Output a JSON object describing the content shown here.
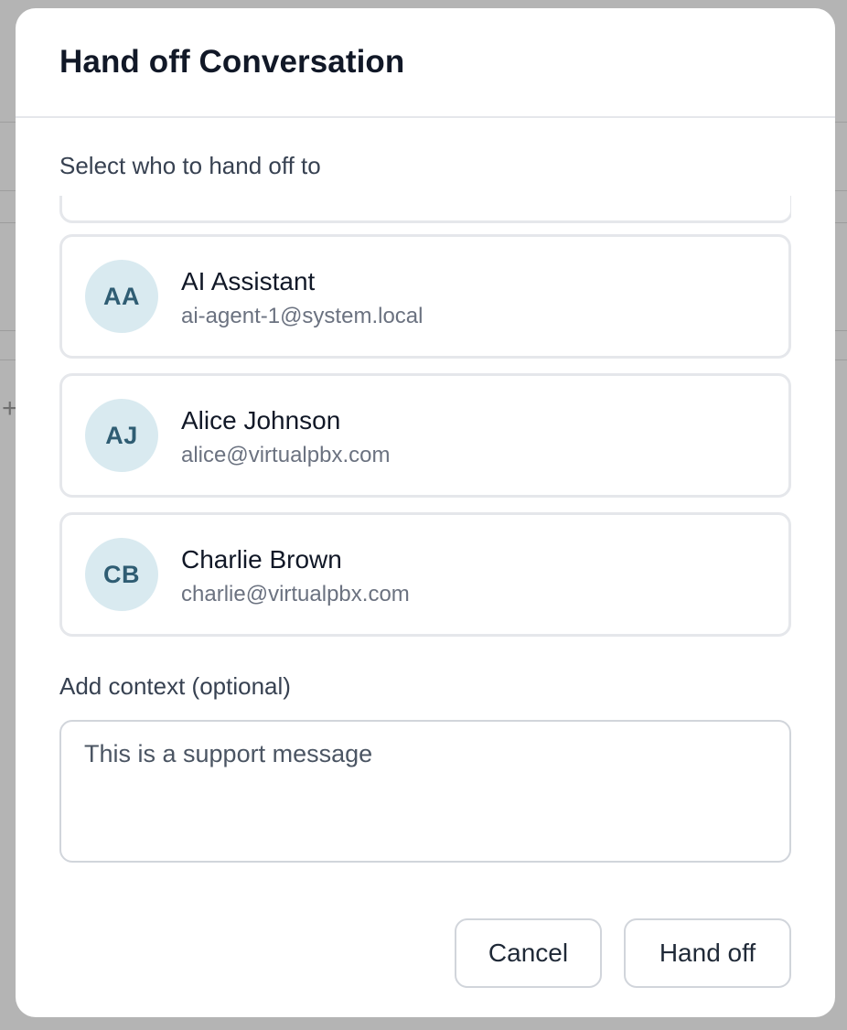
{
  "dialog": {
    "title": "Hand off Conversation",
    "select_label": "Select who to hand off to",
    "agents": [
      {
        "initials": "AA",
        "name": "AI Assistant",
        "email": "ai-agent-1@system.local"
      },
      {
        "initials": "AJ",
        "name": "Alice Johnson",
        "email": "alice@virtualpbx.com"
      },
      {
        "initials": "CB",
        "name": "Charlie Brown",
        "email": "charlie@virtualpbx.com"
      }
    ],
    "context_label": "Add context (optional)",
    "context_placeholder": "This is a support message",
    "cancel_label": "Cancel",
    "handoff_label": "Hand off"
  },
  "colors": {
    "avatar_bg": "#d9eaf0",
    "avatar_text": "#2f5d73",
    "border": "#e5e7eb",
    "title": "#111827"
  }
}
